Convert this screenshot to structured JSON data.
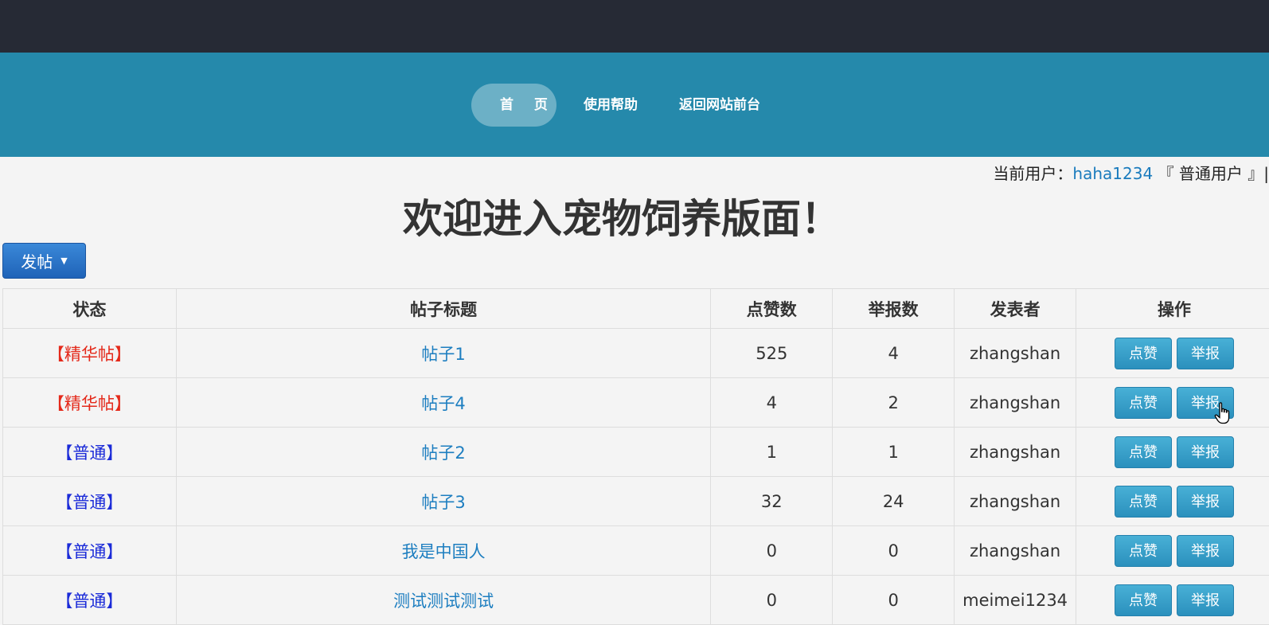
{
  "nav": {
    "items": [
      {
        "label": "首  页"
      },
      {
        "label": "使用帮助"
      },
      {
        "label": "返回网站前台"
      }
    ]
  },
  "user": {
    "prefix": "当前用户：",
    "name": "haha1234",
    "role": "『 普通用户 』|"
  },
  "welcome": "欢迎进入宠物饲养版面！",
  "post_button": {
    "label": "发帖",
    "icon": "caret-down-icon"
  },
  "table": {
    "headers": [
      "状态",
      "帖子标题",
      "点赞数",
      "举报数",
      "发表者",
      "操作"
    ],
    "rows": [
      {
        "status": "【精华帖】",
        "status_type": "essence",
        "title": "帖子1",
        "likes": "525",
        "reports": "4",
        "author": "zhangshan"
      },
      {
        "status": "【精华帖】",
        "status_type": "essence",
        "title": "帖子4",
        "likes": "4",
        "reports": "2",
        "author": "zhangshan"
      },
      {
        "status": "【普通】",
        "status_type": "normal",
        "title": "帖子2",
        "likes": "1",
        "reports": "1",
        "author": "zhangshan"
      },
      {
        "status": "【普通】",
        "status_type": "normal",
        "title": "帖子3",
        "likes": "32",
        "reports": "24",
        "author": "zhangshan"
      },
      {
        "status": "【普通】",
        "status_type": "normal",
        "title": "我是中国人",
        "likes": "0",
        "reports": "0",
        "author": "zhangshan"
      },
      {
        "status": "【普通】",
        "status_type": "normal",
        "title": "测试测试测试",
        "likes": "0",
        "reports": "0",
        "author": "meimei1234"
      }
    ],
    "like_label": "点赞",
    "report_label": "举报"
  },
  "colors": {
    "topbar": "#262a35",
    "navband": "#2589ab",
    "essence": "#e4291a",
    "normal": "#1a2ad8",
    "link": "#1d7ec0"
  }
}
